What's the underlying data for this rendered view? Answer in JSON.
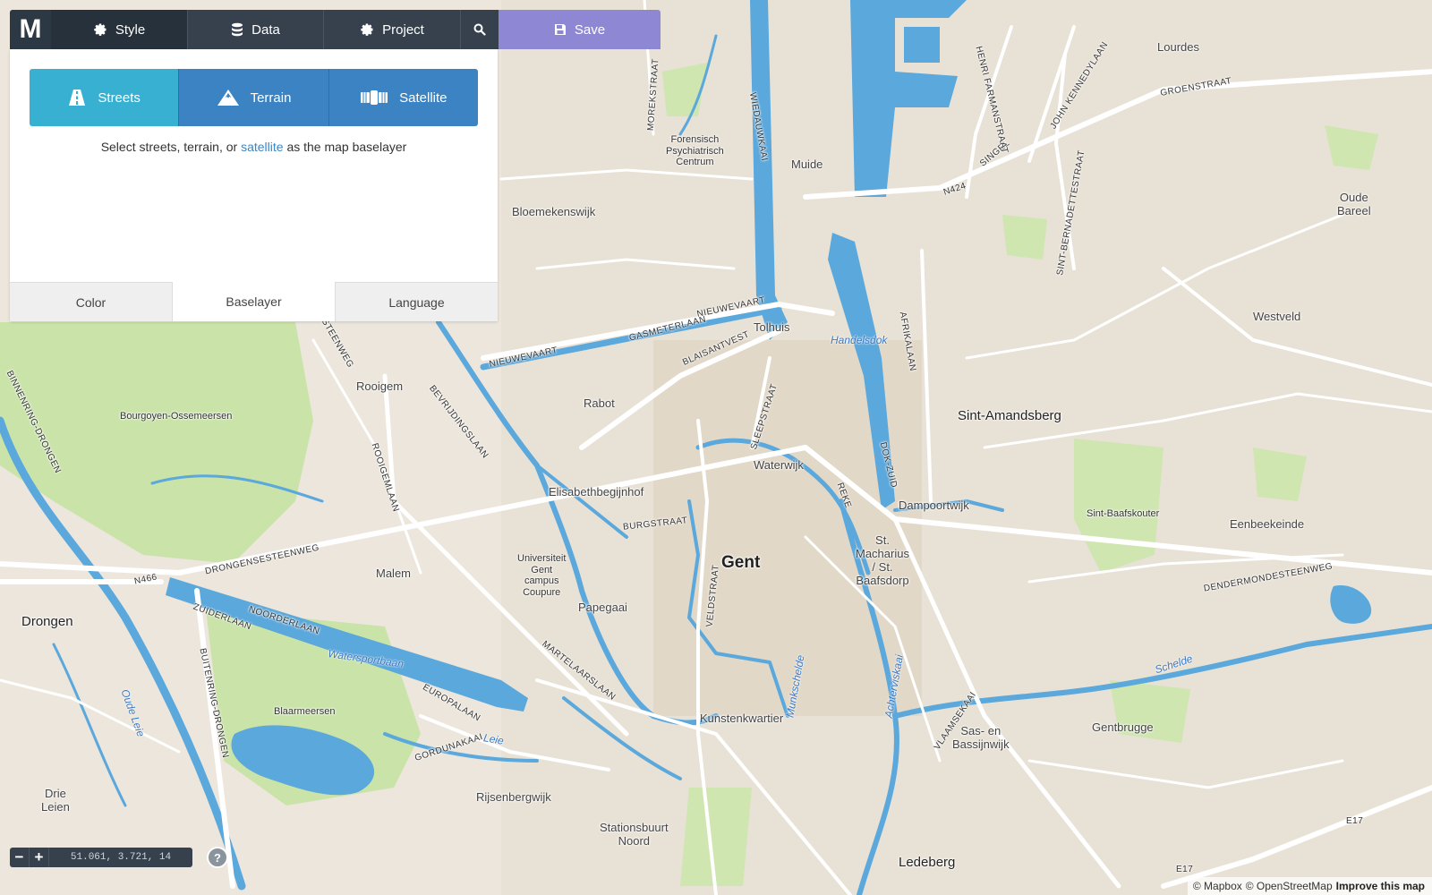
{
  "toolbar": {
    "logo": "M",
    "style_label": "Style",
    "data_label": "Data",
    "project_label": "Project",
    "save_label": "Save",
    "colors": {
      "dark": "#36414d",
      "active": "#26313b",
      "save": "#8e88d4"
    }
  },
  "panel": {
    "baselayers": [
      {
        "label": "Streets",
        "icon": "road-icon",
        "selected": true
      },
      {
        "label": "Terrain",
        "icon": "mountain-icon",
        "selected": false
      },
      {
        "label": "Satellite",
        "icon": "satellite-icon",
        "selected": false
      }
    ],
    "hint_before": "Select streets, terrain, or ",
    "hint_link": "satellite",
    "hint_after": " as the map baselayer",
    "tabs": [
      {
        "label": "Color",
        "active": false
      },
      {
        "label": "Baselayer",
        "active": true
      },
      {
        "label": "Language",
        "active": false
      }
    ],
    "colors": {
      "selected": "#38b0d2",
      "unselected": "#3b83c2"
    }
  },
  "zoom": {
    "minus": "−",
    "plus": "+",
    "coords": "51.061, 3.721, 14"
  },
  "help": "?",
  "attribution": {
    "mapbox": "© Mapbox",
    "osm": "© OpenStreetMap",
    "improve": "Improve this map"
  },
  "map": {
    "labels": {
      "gent": "Gent",
      "sint_amandsberg": "Sint-Amandsberg",
      "drongen": "Drongen",
      "ledeberg": "Ledeberg",
      "lourdes": "Lourdes",
      "oude_bareel": "Oude\nBareel",
      "westveld": "Westveld",
      "muide": "Muide",
      "forensisch": "Forensisch\nPsychiatrisch\nCentrum",
      "bloemekenswijk": "Bloemekenswijk",
      "tolhuis": "Tolhuis",
      "rooigem": "Rooigem",
      "rabot": "Rabot",
      "bourgoyen": "Bourgoyen-Ossemeersen",
      "elisabethbegijnhof": "Elisabethbegijnhof",
      "waterwijk": "Waterwijk",
      "dampoortwijk": "Dampoortwijk",
      "sint_baafskouter": "Sint-Baafskouter",
      "eenbeekeinde": "Eenbeekeinde",
      "malem": "Malem",
      "universiteit": "Universiteit\nGent\ncampus\nCoupure",
      "macharius": "St.\nMacharius\n/ St.\nBaafsdorp",
      "papegaai": "Papegaai",
      "blaarmeersen": "Blaarmeersen",
      "kunstenkwartier": "Kunstenkwartier",
      "sas_bassijnwijk": "Sas- en\nBassijnwijk",
      "gentbrugge": "Gentbrugge",
      "drie_leien": "Drie\nLeien",
      "rijsenbergwijk": "Rijsenbergwijk",
      "stationsbuurt": "Stationsbuurt\nNoord",
      "handelsdok": "Handelsdok",
      "watersportbaan": "Watersportbaan",
      "schelde": "Schelde",
      "nieuwevaart": "NIEUWEVAART",
      "gasmeterlaan": "GASMETERLAAN",
      "blaisantvest": "BLAISANTVEST",
      "sleepstraat": "SLEEPSTRAAT",
      "burgstraat": "BURGSTRAAT",
      "drongensesteenweg": "DRONGENSESTEENWEG",
      "n466": "N466",
      "noorderlaan": "NOORDERLAAN",
      "zuiderlaan": "ZUIDERLAAN",
      "martelaarslaan": "MARTELAARSLAAN",
      "europalaan": "EUROPALAAN",
      "gordunakaai": "GORDUNAKAAI",
      "bevrijdingslaan": "BEVRIJDINGSLAAN",
      "rooigemlaan": "ROOIGEMLAAN",
      "afrikalaan": "AFRIKALAAN",
      "dok_zuid": "DOK-ZUID",
      "veldstraat": "VELDSTRAAT",
      "dendermondesteenweg": "DENDERMONDESTEENWEG",
      "vlaamsekaai": "VLAAMSEKAAI",
      "n424": "N424",
      "singel": "SINGEL",
      "groenstraat": "GROENSTRAAT",
      "e17": "E17",
      "morekstraat": "MOREKSTRAAT",
      "wiedauwkaai": "WIEDAUWKAAI",
      "henri_farman": "HENRI FARMANSTRAAT",
      "john_kennedy": "JOHN KENNEDYLAAN",
      "sint_bernadette": "SINT-BERNADETTESTRAAT",
      "binnenring": "BINNENRING-DRONGEN",
      "buitenring": "BUITENRING-DRONGEN",
      "steenweg": "STEENWEG",
      "reke": "REKE",
      "oude_leie": "Oude Leie",
      "leie": "Leie",
      "munkschelde": "Munkschelde",
      "achterviskaai": "Achterviskaai"
    },
    "colors": {
      "land": "#ece6dc",
      "water": "#5ba8dc",
      "park": "#c9e3a8",
      "road": "#ffffff"
    }
  }
}
